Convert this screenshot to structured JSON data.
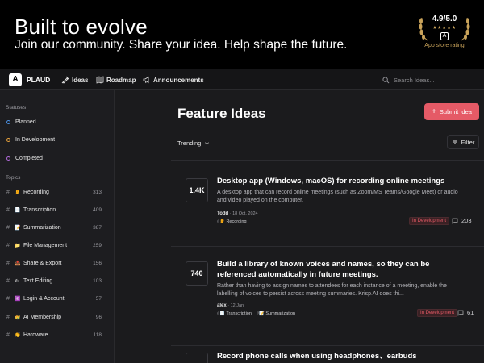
{
  "banner": {
    "title": "Built to evolve",
    "subtitle": "Join our community. Share your idea. Help shape the future.",
    "rating_score": "4.9/5.0",
    "rating_stars": "★★★★★",
    "rating_caption": "App store rating"
  },
  "nav": {
    "brand": "PLAUD",
    "items": [
      "Ideas",
      "Roadmap",
      "Announcements"
    ],
    "search_placeholder": "Search Ideas..."
  },
  "sidebar": {
    "statuses_heading": "Statuses",
    "statuses": [
      {
        "label": "Planned",
        "color": "#4a90e2"
      },
      {
        "label": "In Development",
        "color": "#e8a33d"
      },
      {
        "label": "Completed",
        "color": "#b06ad8"
      }
    ],
    "topics_heading": "Topics",
    "topics": [
      {
        "emoji": "👂",
        "label": "Recording",
        "count": "313"
      },
      {
        "emoji": "📄",
        "label": "Transcription",
        "count": "409"
      },
      {
        "emoji": "📝",
        "label": "Summarization",
        "count": "387"
      },
      {
        "emoji": "📁",
        "label": "File Management",
        "count": "259"
      },
      {
        "emoji": "📤",
        "label": "Share & Export",
        "count": "156"
      },
      {
        "emoji": "✍",
        "label": "Text Editing",
        "count": "103"
      },
      {
        "emoji": "🆔",
        "label": "Login & Account",
        "count": "57"
      },
      {
        "emoji": "👑",
        "label": "AI Membership",
        "count": "96"
      },
      {
        "emoji": "👏",
        "label": "Hardware",
        "count": "118"
      }
    ]
  },
  "main": {
    "title": "Feature Ideas",
    "submit_label": "Submit Idea",
    "sort_label": "Trending",
    "filter_label": "Filter",
    "ideas": [
      {
        "votes": "1.4K",
        "title": "Desktop app (Windows, macOS) for recording online meetings",
        "description": "A desktop app that can record online meetings (such as Zoom/MS Teams/Google Meet) or audio and video played on the computer.",
        "author": "Todd",
        "date": "18 Oct, 2024",
        "tags": [
          "👂 Recording"
        ],
        "status": "In Development",
        "comments": "203"
      },
      {
        "votes": "740",
        "title": "Build a library of known voices and names, so they can be referenced automatically in future meetings.",
        "description": "Rather than having to assign names to attendees for each instance of a meeting, enable the labelling of voices to persist across meeting summaries. Krisp.AI does thi...",
        "author": "alex",
        "date": "12 Jan",
        "tags": [
          "📄 Transcription",
          "📝 Summarization"
        ],
        "status": "In Development",
        "comments": "61"
      },
      {
        "title": "Record phone calls when using headphones、earbuds"
      }
    ]
  },
  "colors": {
    "accent": "#e55a66",
    "background": "#1b1b1d",
    "banner": "#000000"
  }
}
